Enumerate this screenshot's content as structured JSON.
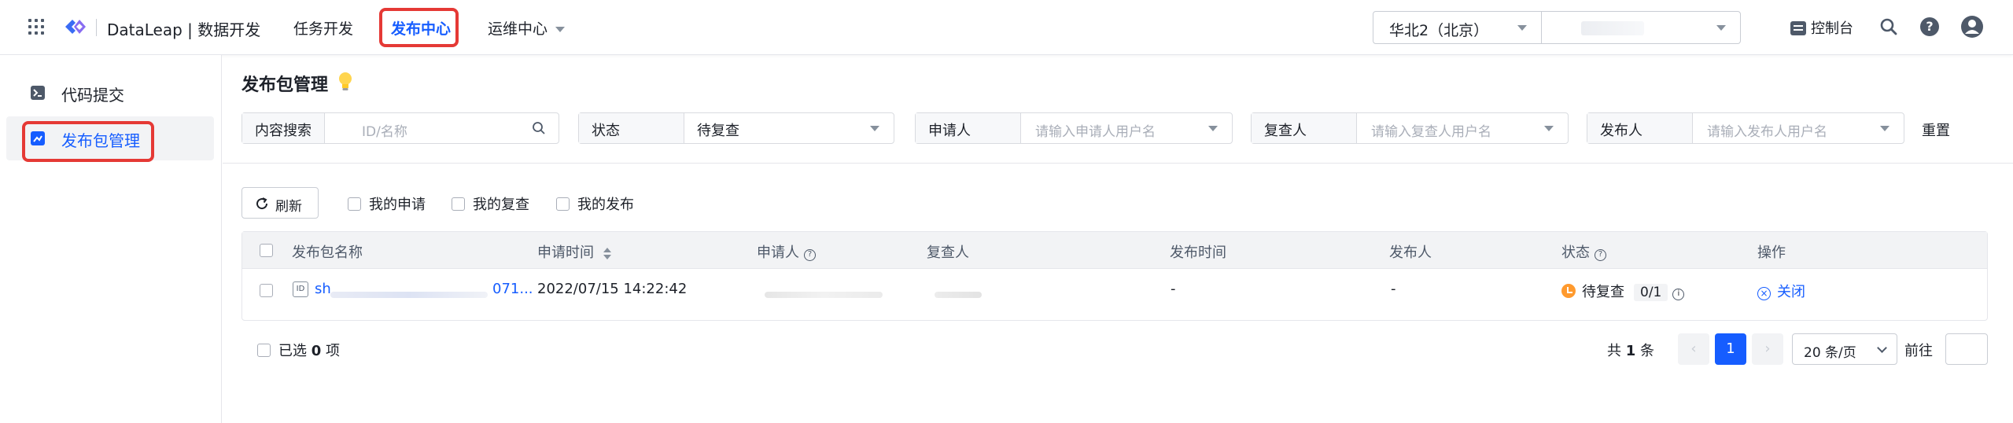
{
  "brand": {
    "name": "DataLeap | 数据开发"
  },
  "nav": {
    "items": [
      {
        "label": "任务开发"
      },
      {
        "label": "发布中心"
      },
      {
        "label": "运维中心"
      }
    ]
  },
  "header": {
    "region": "华北2（北京）",
    "account_suffix": "​",
    "console_label": "控制台"
  },
  "sidebar": {
    "items": [
      {
        "label": "代码提交"
      },
      {
        "label": "发布包管理"
      }
    ]
  },
  "page": {
    "title": "发布包管理"
  },
  "filters": {
    "search": {
      "label": "内容搜索",
      "placeholder": "ID/名称"
    },
    "status": {
      "label": "状态",
      "value": "待复查"
    },
    "applicant": {
      "label": "申请人",
      "placeholder": "请输入申请人用户名"
    },
    "reviewer": {
      "label": "复查人",
      "placeholder": "请输入复查人用户名"
    },
    "publisher": {
      "label": "发布人",
      "placeholder": "请输入发布人用户名"
    },
    "reset_label": "重置"
  },
  "toolbar": {
    "refresh_label": "刷新",
    "checkboxes": [
      {
        "label": "我的申请"
      },
      {
        "label": "我的复查"
      },
      {
        "label": "我的发布"
      }
    ]
  },
  "table": {
    "columns": [
      "发布包名称",
      "申请时间",
      "申请人",
      "复查人",
      "发布时间",
      "发布人",
      "状态",
      "操作"
    ],
    "rows": [
      {
        "name_prefix": "sh",
        "name_suffix": "071...",
        "apply_time": "2022/07/15  14:22:42",
        "publish_time": "-",
        "publisher": "-",
        "status": "待复查",
        "progress": "0/1",
        "action": "关闭"
      }
    ]
  },
  "footer": {
    "selected_prefix": "已选",
    "selected_count": "0",
    "selected_suffix": "项",
    "total_prefix": "共",
    "total_count": "1",
    "total_suffix": "条",
    "current_page": "1",
    "page_size": "20 条/页",
    "goto_label": "前往"
  },
  "colors": {
    "accent": "#165dff",
    "highlight": "#e53935",
    "status_pending": "#ff9a2e"
  },
  "icons": [
    "apps-grid-icon",
    "dataleap-logo-icon",
    "console-icon",
    "search-icon",
    "help-icon",
    "user-avatar-icon",
    "code-submit-icon",
    "package-manage-icon",
    "bulb-icon",
    "refresh-icon",
    "question-icon",
    "close-circle-icon"
  ]
}
